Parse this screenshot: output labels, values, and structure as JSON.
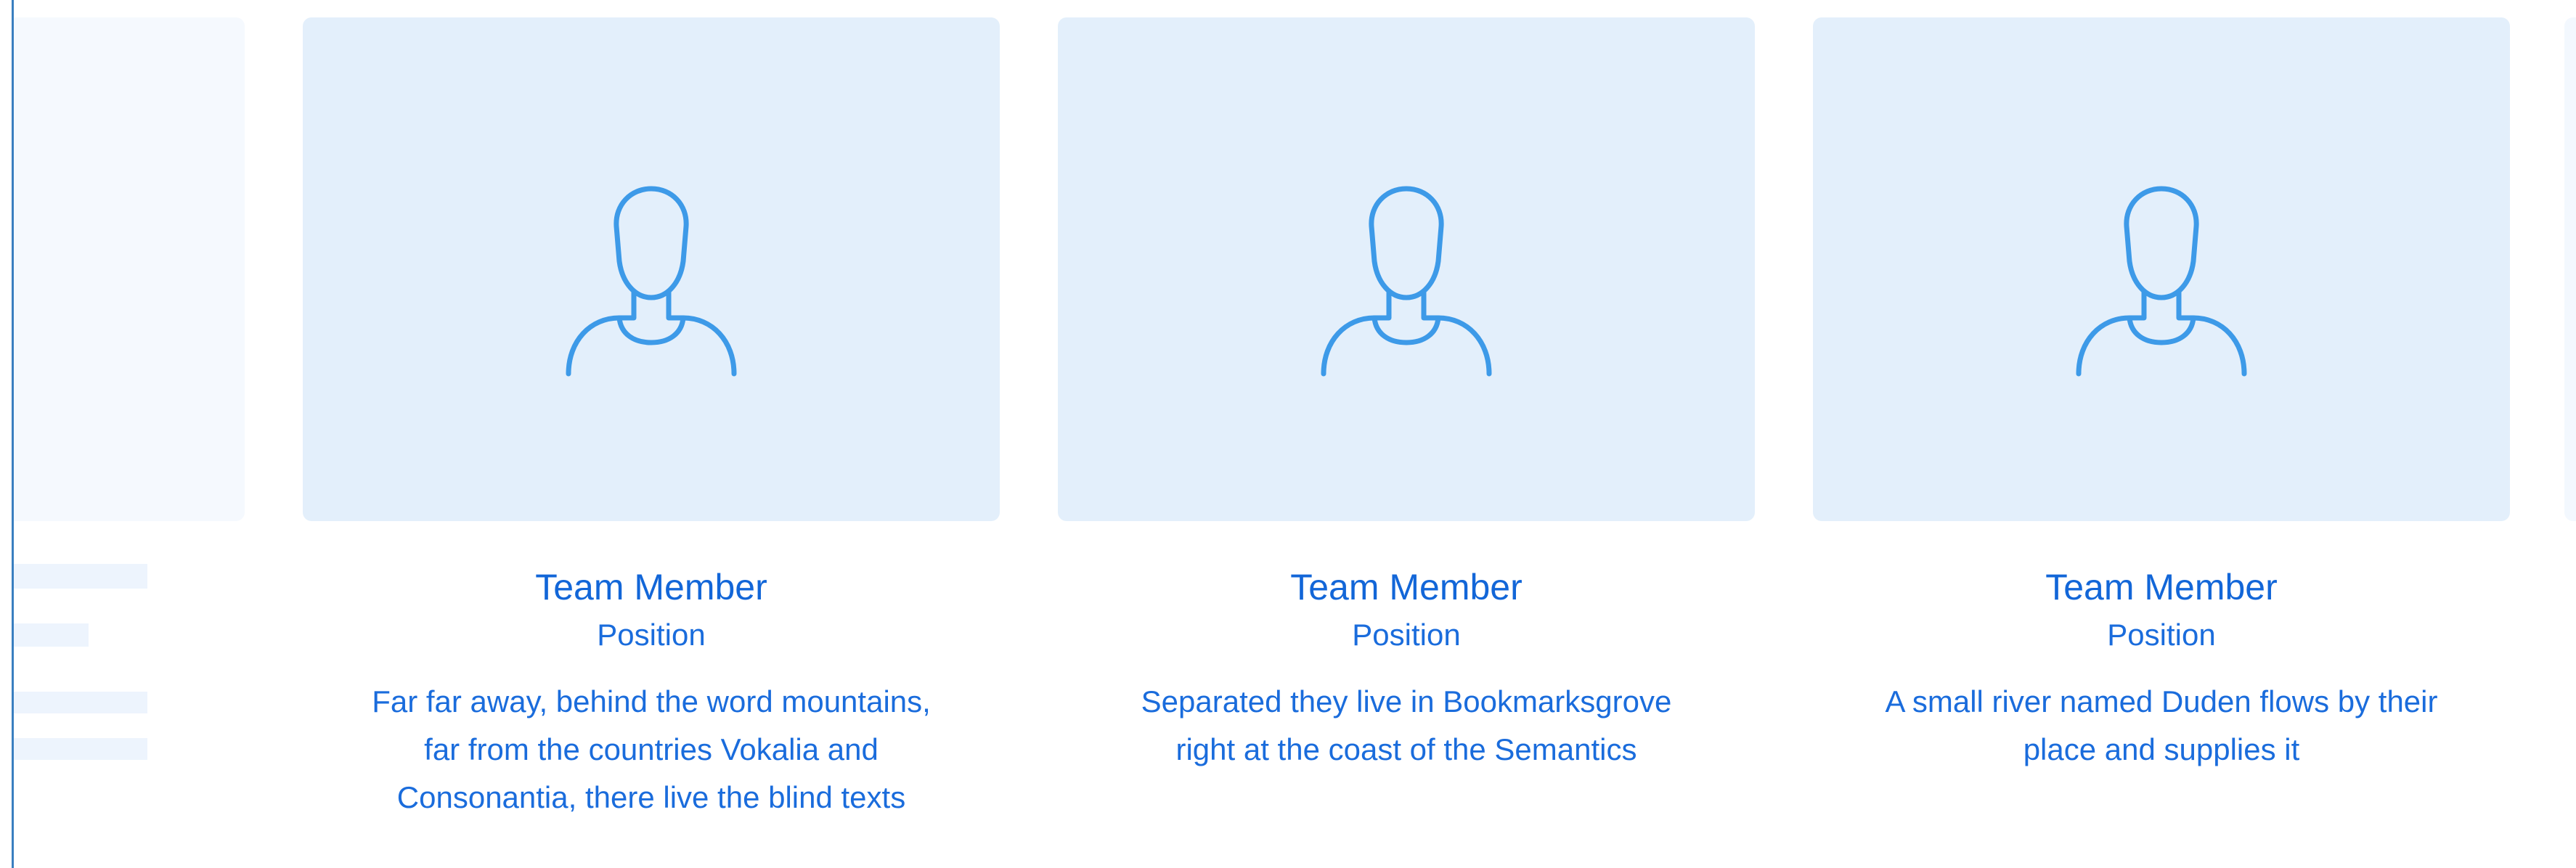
{
  "colors": {
    "accent": "#1266d8",
    "photo_bg": "#e3effb",
    "icon_stroke": "#3d9ae8"
  },
  "team": [
    {
      "icon": "user-avatar-icon",
      "name": "Team Member",
      "position": "Position",
      "bio": "Far far away, behind the word mountains, far from the countries Vokalia and Consonantia, there live the blind texts"
    },
    {
      "icon": "user-avatar-icon",
      "name": "Team Member",
      "position": "Position",
      "bio": "Separated they live in Bookmarksgrove right at the coast of the Semantics"
    },
    {
      "icon": "user-avatar-icon",
      "name": "Team Member",
      "position": "Position",
      "bio": "A small river named Duden flows by their place and supplies it"
    }
  ]
}
